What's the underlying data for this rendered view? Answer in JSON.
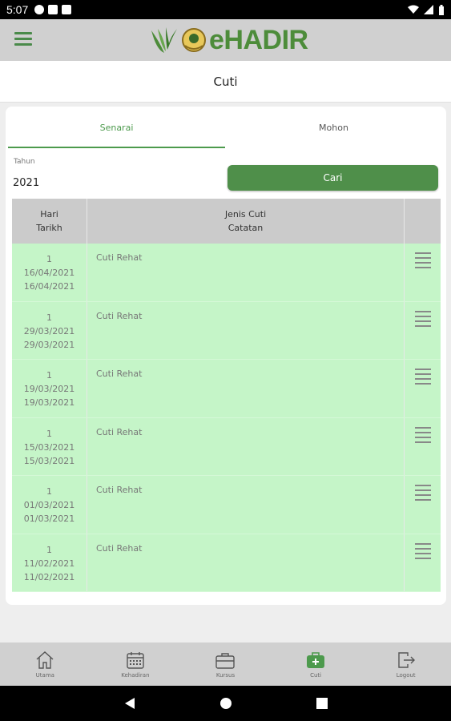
{
  "status_bar": {
    "time": "5:07"
  },
  "app": {
    "logo_text": "eHADIR"
  },
  "page": {
    "title": "Cuti"
  },
  "tabs": [
    {
      "label": "Senarai"
    },
    {
      "label": "Mohon"
    }
  ],
  "filter": {
    "year_label": "Tahun",
    "year_value": "2021",
    "search_label": "Cari"
  },
  "table": {
    "headers": {
      "hari": "Hari",
      "tarikh": "Tarikh",
      "jenis": "Jenis Cuti",
      "catatan": "Catatan"
    },
    "rows": [
      {
        "hari": "1",
        "tarikh_mula": "16/04/2021",
        "tarikh_akhir": "16/04/2021",
        "jenis": "Cuti Rehat"
      },
      {
        "hari": "1",
        "tarikh_mula": "29/03/2021",
        "tarikh_akhir": "29/03/2021",
        "jenis": "Cuti Rehat"
      },
      {
        "hari": "1",
        "tarikh_mula": "19/03/2021",
        "tarikh_akhir": "19/03/2021",
        "jenis": "Cuti Rehat"
      },
      {
        "hari": "1",
        "tarikh_mula": "15/03/2021",
        "tarikh_akhir": "15/03/2021",
        "jenis": "Cuti Rehat"
      },
      {
        "hari": "1",
        "tarikh_mula": "01/03/2021",
        "tarikh_akhir": "01/03/2021",
        "jenis": "Cuti Rehat"
      },
      {
        "hari": "1",
        "tarikh_mula": "11/02/2021",
        "tarikh_akhir": "11/02/2021",
        "jenis": "Cuti Rehat"
      }
    ]
  },
  "bottom_nav": [
    {
      "label": "Utama",
      "icon": "home-icon"
    },
    {
      "label": "Kehadiran",
      "icon": "calendar-icon"
    },
    {
      "label": "Kursus",
      "icon": "briefcase-icon"
    },
    {
      "label": "Cuti",
      "icon": "medical-bag-icon",
      "active": true
    },
    {
      "label": "Logout",
      "icon": "logout-icon"
    }
  ],
  "colors": {
    "primary": "#4f8f4a",
    "row_bg": "#c5f5c8",
    "header_bg": "#cbcbcb",
    "bar_bg": "#d0d0d0"
  }
}
